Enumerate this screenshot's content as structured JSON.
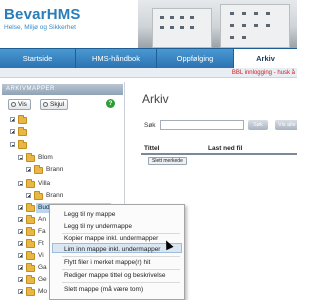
{
  "header": {
    "logo_title": "BevarHMS",
    "logo_subtitle": "Helse, Miljø og Sikkerhet"
  },
  "nav": {
    "tabs": [
      {
        "label": "Startside"
      },
      {
        "label": "HMS-håndbok"
      },
      {
        "label": "Oppfølging"
      },
      {
        "label": "Arkiv",
        "active": true
      }
    ],
    "ticker": "BBL innlogging - husk å"
  },
  "left_panel": {
    "title": "ARKIVMAPPER",
    "vis_label": "Vis",
    "skjul_label": "Skjul",
    "tree": [
      {
        "label": ""
      },
      {
        "label": ""
      },
      {
        "label": ""
      },
      {
        "label": "Blom"
      },
      {
        "label": "Brann"
      },
      {
        "label": "Villa"
      },
      {
        "label": "Brann"
      },
      {
        "label": "Budsjett Nyansatte 2018",
        "selected": true
      },
      {
        "label": "An"
      },
      {
        "label": "Fa"
      },
      {
        "label": "Ft"
      },
      {
        "label": "Vi"
      },
      {
        "label": "Ga"
      },
      {
        "label": "Ge"
      },
      {
        "label": "Mo"
      }
    ]
  },
  "main": {
    "title": "Arkiv",
    "search_label": "Søk",
    "search_value": "",
    "search_button": "Søk",
    "show_all_button": "Vis alle",
    "col_title": "Tittel",
    "col_download": "Last ned fil",
    "delete_marked": "Slett merkede"
  },
  "context_menu": {
    "items": [
      "Legg til ny mappe",
      "Legg til ny undermappe",
      "Kopier mappe inkl. undermapper",
      "Lim inn mappe inkl. undermapper",
      "Flytt filer i merket mappe(r) hit",
      "Rediger mappe tittel og beskrivelse",
      "Slett mappe (må være tom)"
    ]
  },
  "colors": {
    "brand_blue": "#2a7db8",
    "nav_blue": "#2b73b1",
    "ticker_red": "#d21c1c",
    "folder_yellow": "#e9b748"
  }
}
